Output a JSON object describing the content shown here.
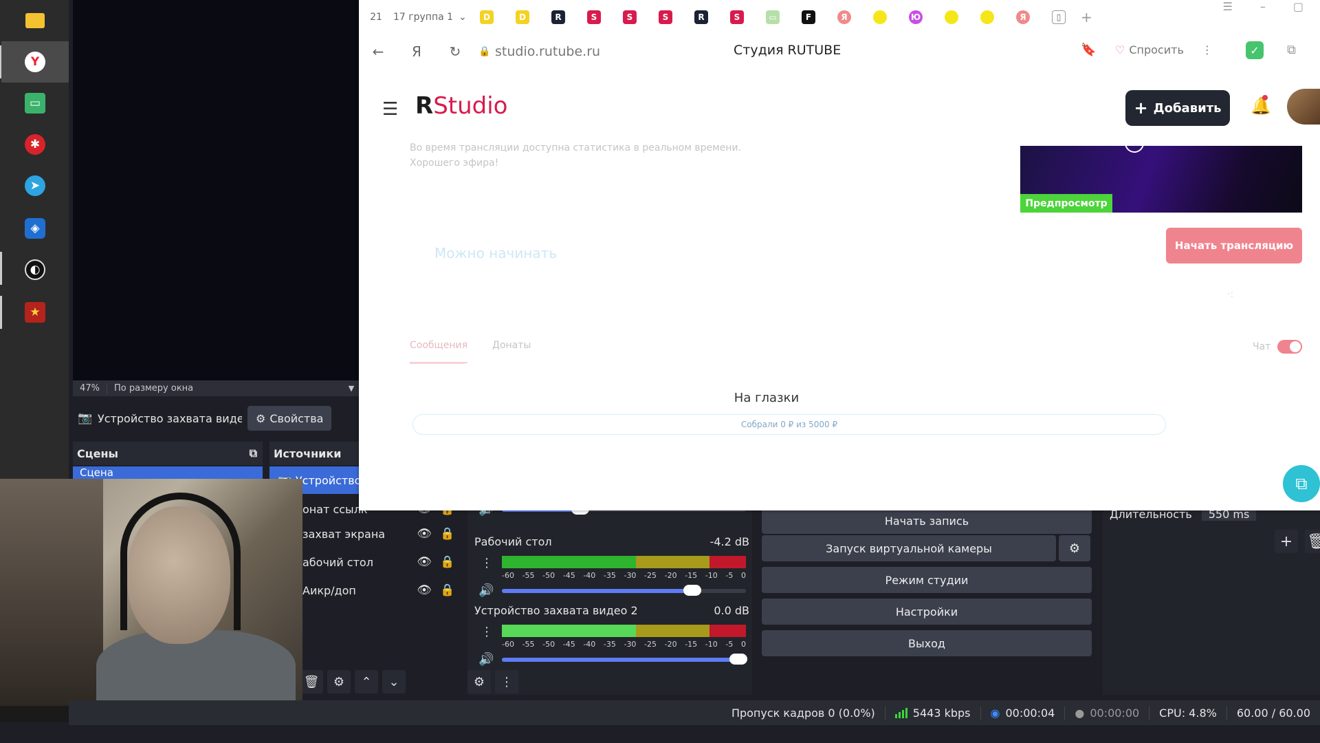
{
  "taskbar": {
    "icons": [
      "folder-icon",
      "yandex-browser-icon",
      "monitor-icon",
      "antivirus-icon",
      "telegram-icon",
      "vpn-shield-icon",
      "obs-icon",
      "game-icon"
    ]
  },
  "obs": {
    "zoom": "47%",
    "zoom_mode": "По размеру окна",
    "selected_source": "Устройство захвата видео",
    "properties_label": "Свойства",
    "scenes_title": "Сцены",
    "sources_title": "Источники",
    "scene_selected": "Сцена",
    "source_selected": "Устройство",
    "sources": [
      {
        "label": "онат ссылк"
      },
      {
        "label": "захват экрана"
      },
      {
        "label": "абочий стол"
      },
      {
        "label": "Аикр/доп"
      }
    ],
    "mixer": {
      "scale": [
        "-60",
        "-55",
        "-50",
        "-45",
        "-40",
        "-35",
        "-30",
        "-25",
        "-20",
        "-15",
        "-10",
        "-5",
        "0"
      ],
      "channels": [
        {
          "name": "Рабочий стол",
          "db": "-4.2 dB",
          "volume": 0.78
        },
        {
          "name": "Устройство захвата видео 2",
          "db": "0.0 dB",
          "volume": 0.97
        }
      ],
      "top_volume": 0.32
    },
    "controls": {
      "start_record": "Начать запись",
      "virtual_cam": "Запуск виртуальной камеры",
      "studio_mode": "Режим студии",
      "settings": "Настройки",
      "exit": "Выход"
    },
    "transition": {
      "duration_label": "Длительность",
      "duration_value": "550 ms"
    },
    "status": {
      "dropped": "Пропуск кадров 0 (0.0%)",
      "bitrate": "5443 kbps",
      "live_time": "00:00:04",
      "rec_time": "00:00:00",
      "cpu": "CPU: 4.8%",
      "fps": "60.00 / 60.00"
    }
  },
  "browser": {
    "tab_count": "21",
    "group_label": "17  группа 1",
    "url": "studio.rutube.ru",
    "page_title": "Студия RUTUBE",
    "ask_label": "Спросить"
  },
  "studio": {
    "logo_r": "R",
    "logo_studio": "Studio",
    "add_button": "Добавить",
    "info_line1": "Во время трансляции доступна статистика в реальном времени.",
    "info_line2": "Хорошего эфира!",
    "preview_badge": "Предпросмотр",
    "start_stream": "Начать трансляцию",
    "ready_text": "Можно начинать",
    "tab_messages": "Сообщения",
    "tab_donate": "Донаты",
    "chat_label": "Чат",
    "goal_title": "На глазки",
    "goal_collected": "Собрали 0 ₽  из 5000 ₽"
  }
}
